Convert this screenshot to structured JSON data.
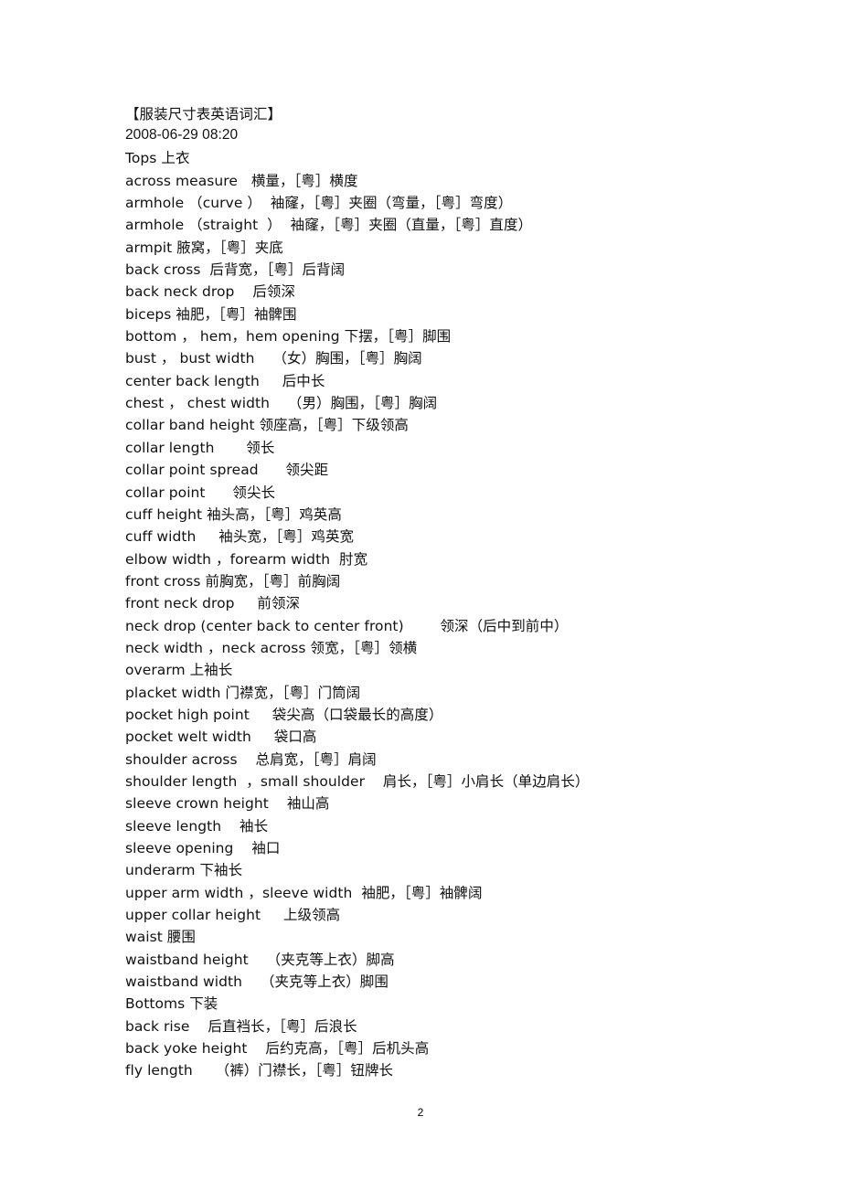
{
  "document": {
    "title": "【服装尺寸表英语词汇】",
    "date": "2008-06-29 08:20",
    "page_number": "2",
    "sections": [
      {
        "heading": "Tops 上衣",
        "entries": [
          "across measure   横量，［粤］横度",
          "armhole （curve ）  袖窿，［粤］夹圈（弯量，［粤］弯度）",
          "armhole （straight  ）  袖窿，［粤］夹圈（直量，［粤］直度）",
          "armpit 腋窝，［粤］夹底",
          "back cross  后背宽，［粤］后背阔",
          "back neck drop    后领深",
          "biceps 袖肥，［粤］袖髀围",
          "bottom ， hem，hem opening 下摆，［粤］脚围",
          "bust ， bust width    （女）胸围，［粤］胸阔",
          "center back length     后中长",
          "chest ， chest width    （男）胸围，［粤］胸阔",
          "collar band height 领座高，［粤］下级领高",
          "collar length       领长",
          "collar point spread      领尖距",
          "collar point      领尖长",
          "cuff height 袖头高，［粤］鸡英高",
          "cuff width     袖头宽，［粤］鸡英宽",
          "elbow width ，forearm width  肘宽",
          "front cross 前胸宽，［粤］前胸阔",
          "front neck drop     前领深",
          "neck drop (center back to center front)        领深（后中到前中）",
          "neck width ，neck across 领宽，［粤］领横",
          "overarm 上袖长",
          "placket width 门襟宽，［粤］门筒阔",
          "pocket high point     袋尖高（口袋最长的高度）",
          "pocket welt width     袋口高",
          "shoulder across    总肩宽，［粤］肩阔",
          "shoulder length  ，small shoulder    肩长，［粤］小肩长（单边肩长）",
          "sleeve crown height    袖山高",
          "sleeve length    袖长",
          "sleeve opening    袖口",
          "underarm 下袖长",
          "upper arm width ，sleeve width  袖肥，［粤］袖髀阔",
          "upper collar height     上级领高",
          "waist 腰围",
          "waistband height    （夹克等上衣）脚高",
          "waistband width    （夹克等上衣）脚围"
        ]
      },
      {
        "heading": "Bottoms 下装",
        "entries": [
          "back rise    后直裆长，［粤］后浪长",
          "back yoke height    后约克高，［粤］后机头高",
          "fly length     （裤）门襟长，［粤］钮牌长"
        ]
      }
    ]
  }
}
